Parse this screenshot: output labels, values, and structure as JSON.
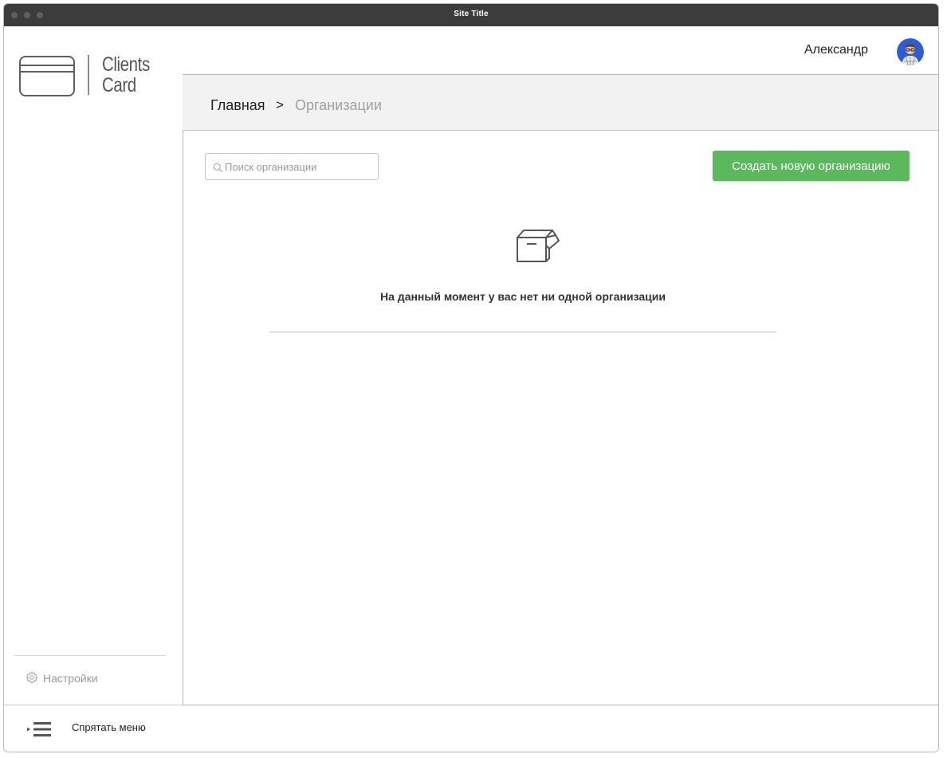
{
  "window": {
    "title": "Site Title"
  },
  "logo": {
    "line1": "Clients",
    "line2": "Card"
  },
  "header": {
    "username": "Александр"
  },
  "breadcrumb": {
    "home": "Главная",
    "separator": ">",
    "current": "Организации"
  },
  "search": {
    "placeholder": "Поиск организации",
    "value": ""
  },
  "actions": {
    "create_label": "Создать новую организацию"
  },
  "empty_state": {
    "message": "На данный момент у вас нет ни одной организации"
  },
  "sidebar": {
    "settings_label": "Настройки",
    "hide_menu_label": "Спрятать меню"
  },
  "colors": {
    "accent": "#5cb85c",
    "titlebar": "#3c3c3e",
    "breadcrumb_bg": "#f2f2f2"
  },
  "icons": [
    "search-icon",
    "gear-icon",
    "hide-menu-icon",
    "box-icon",
    "avatar"
  ]
}
